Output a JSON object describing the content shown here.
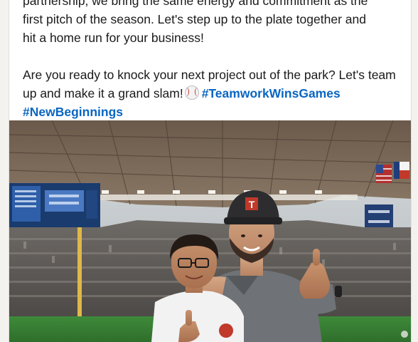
{
  "post": {
    "line1": "partnership, we bring the same energy and commitment as the",
    "line2": "first pitch of the season. Let's step up to the plate together and",
    "line3": "hit a home run for your business!",
    "cta_text": "Are you ready to knock your next project out of the park? Let's team up and make it a grand slam!",
    "hashtag1": "#TeamworkWinsGames",
    "hashtag2": "#NewBeginnings"
  },
  "photo": {
    "icon": "baseball-emoji-icon",
    "cap_logo_letter": "T"
  }
}
